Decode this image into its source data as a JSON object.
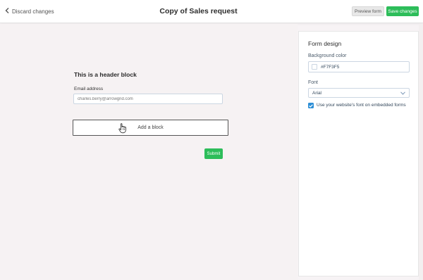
{
  "header": {
    "back_label": "Discard changes",
    "title": "Copy of Sales request",
    "preview_label": "Preview form",
    "save_label": "Save changes"
  },
  "form": {
    "header_block": "This is a header block",
    "email_label": "Email address",
    "email_placeholder": "charles.berry@arrowgrid.com",
    "add_block_label": "Add a block",
    "submit_label": "Submit"
  },
  "design_panel": {
    "title": "Form design",
    "background_color_label": "Background color",
    "background_color_value": "#F7F3F5",
    "font_label": "Font",
    "font_value": "Arial",
    "embed_font_checked": true,
    "embed_font_label": "Use your website's font on embedded forms"
  },
  "colors": {
    "accent_green": "#2dbd5a",
    "checkbox_blue": "#2e8fd6",
    "canvas_background": "#F7F3F5"
  }
}
